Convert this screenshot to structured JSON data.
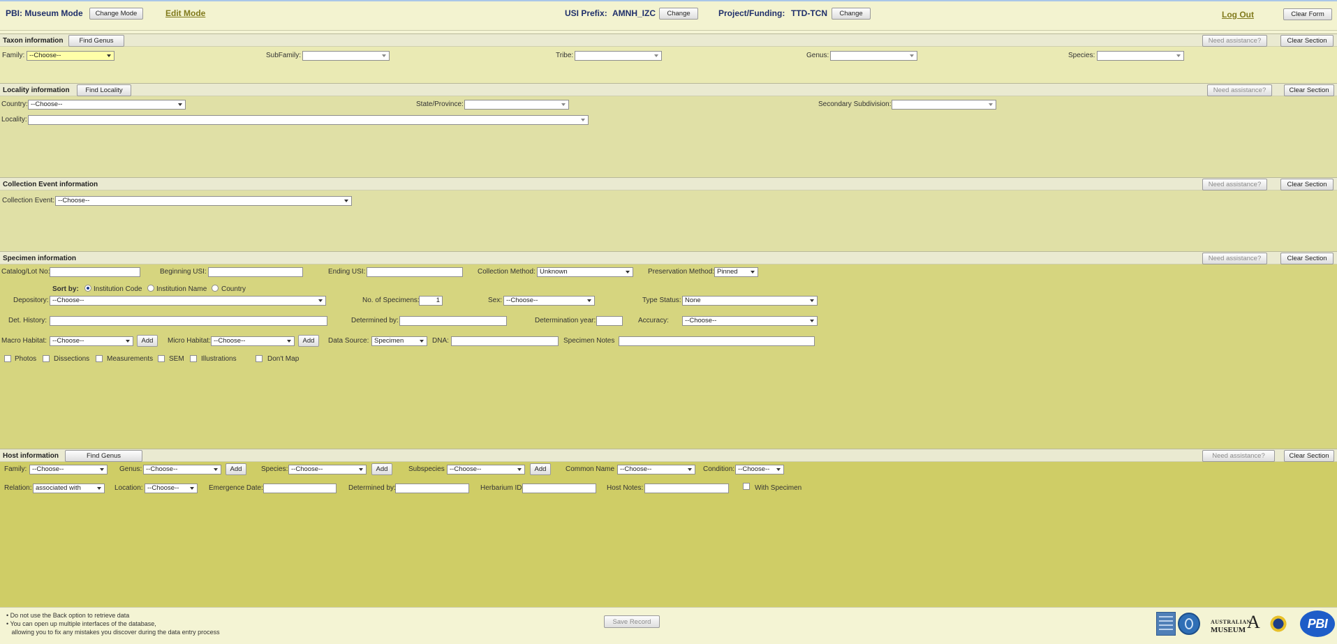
{
  "header": {
    "mode_label": "PBI: Museum Mode",
    "change_mode_label": "Change Mode",
    "edit_mode_label": "Edit Mode",
    "usi_prefix_label": "USI Prefix:",
    "usi_prefix_value": "AMNH_IZC",
    "usi_change_label": "Change",
    "project_label": "Project/Funding:",
    "project_value": "TTD-TCN",
    "project_change_label": "Change",
    "logout_label": "Log Out",
    "clear_form_label": "Clear Form"
  },
  "common": {
    "need_assistance": "Need assistance?",
    "clear_section": "Clear Section",
    "add": "Add"
  },
  "taxon": {
    "title": "Taxon information",
    "find_label": "Find Genus",
    "family_label": "Family:",
    "family_value": "--Choose--",
    "subfamily_label": "SubFamily:",
    "subfamily_value": "",
    "tribe_label": "Tribe:",
    "tribe_value": "",
    "genus_label": "Genus:",
    "genus_value": "",
    "species_label": "Species:",
    "species_value": ""
  },
  "locality": {
    "title": "Locality information",
    "find_label": "Find Locality",
    "country_label": "Country:",
    "country_value": "--Choose--",
    "state_label": "State/Province:",
    "state_value": "",
    "secondary_label": "Secondary Subdivision:",
    "secondary_value": "",
    "locality_label": "Locality:",
    "locality_value": ""
  },
  "collection_event": {
    "title": "Collection Event information",
    "label": "Collection Event:",
    "value": "--Choose--"
  },
  "specimen": {
    "title": "Specimen information",
    "catalog_label": "Catalog/Lot No:",
    "beginning_usi_label": "Beginning USI:",
    "ending_usi_label": "Ending USI:",
    "collection_method_label": "Collection Method:",
    "collection_method_value": "Unknown",
    "preservation_method_label": "Preservation Method:",
    "preservation_method_value": "Pinned",
    "sort_by_label": "Sort by:",
    "sort_options": [
      "Institution Code",
      "Institution Name",
      "Country"
    ],
    "depository_label": "Depository:",
    "depository_value": "--Choose--",
    "num_specimens_label": "No. of Specimens:",
    "num_specimens_value": "1",
    "sex_label": "Sex:",
    "sex_value": "--Choose--",
    "type_status_label": "Type Status:",
    "type_status_value": "None",
    "det_history_label": "Det. History:",
    "determined_by_label": "Determined by:",
    "determination_year_label": "Determination year:",
    "accuracy_label": "Accuracy:",
    "accuracy_value": "--Choose--",
    "macro_habitat_label": "Macro Habitat:",
    "macro_habitat_value": "--Choose--",
    "micro_habitat_label": "Micro Habitat:",
    "micro_habitat_value": "--Choose--",
    "data_source_label": "Data Source:",
    "data_source_value": "Specimen",
    "dna_label": "DNA:",
    "specimen_notes_label": "Specimen Notes",
    "checkboxes": [
      "Photos",
      "Dissections",
      "Measurements",
      "SEM",
      "Illustrations",
      "Don't Map"
    ]
  },
  "host": {
    "title": "Host information",
    "find_label": "Find Genus",
    "family_label": "Family:",
    "family_value": "--Choose--",
    "genus_label": "Genus:",
    "genus_value": "--Choose--",
    "species_label": "Species:",
    "species_value": "--Choose--",
    "subspecies_label": "Subspecies",
    "subspecies_value": "--Choose--",
    "common_name_label": "Common Name",
    "common_name_value": "--Choose--",
    "condition_label": "Condition:",
    "condition_value": "--Choose--",
    "relation_label": "Relation:",
    "relation_value": "associated with",
    "location_label": "Location:",
    "location_value": "--Choose--",
    "emergence_label": "Emergence Date:",
    "determined_by_label": "Determined by:",
    "herbarium_label": "Herbarium ID:",
    "host_notes_label": "Host Notes:",
    "with_specimen_label": "With Specimen"
  },
  "footer": {
    "notes": [
      "• Do not use the Back option to retrieve data",
      "• You can open up multiple interfaces of the database,",
      "   allowing you to fix any mistakes you discover during the data entry process"
    ],
    "save_label": "Save Record",
    "logo_australian": "AUSTRALIAN",
    "logo_museum": "MUSEUM",
    "logo_pbi": "PBI"
  },
  "colors": {
    "taxon_bg": "#eaeab4",
    "locality_bg": "#e0e0a6",
    "collection_bg": "#e0e0a6",
    "specimen_bg": "#d6d57f",
    "host_bg": "#cfcd66",
    "accent_navy": "#1f2f6a",
    "accent_olive": "#807a1c"
  }
}
